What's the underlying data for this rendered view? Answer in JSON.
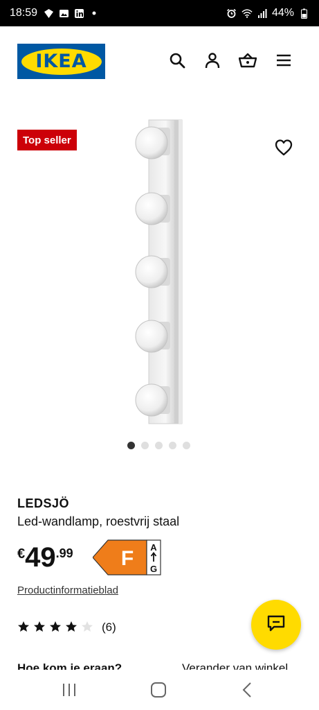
{
  "status_bar": {
    "time": "18:59",
    "left_icons": [
      "messenger-icon",
      "gallery-icon",
      "linkedin-icon",
      "dot-icon"
    ],
    "right_icons": [
      "alarm-icon",
      "wifi-icon",
      "signal-icon",
      "battery-icon"
    ],
    "battery": "44%"
  },
  "header": {
    "logo_text": "IKEA",
    "icons": [
      "search-icon",
      "user-icon",
      "basket-icon",
      "menu-icon"
    ]
  },
  "product": {
    "badge": "Top seller",
    "name": "LEDSJÖ",
    "description": "Led-wandlamp, roestvrij staal",
    "price_currency": "€",
    "price_integer": "49",
    "price_decimal": ".99",
    "energy_class": "F",
    "energy_scale_top": "A",
    "energy_scale_bottom": "G",
    "info_link": "Productinformatieblad",
    "rating": 4,
    "rating_max": 5,
    "review_count": "(6)",
    "image_count": 5,
    "active_image": 1
  },
  "below_fold": {
    "left": "Hoe kom je eraan?",
    "right": "Verander van winkel"
  },
  "colors": {
    "brand_blue": "#0058a3",
    "brand_yellow": "#ffdb00",
    "badge_red": "#cc0008",
    "energy_orange": "#ef7d1a"
  }
}
